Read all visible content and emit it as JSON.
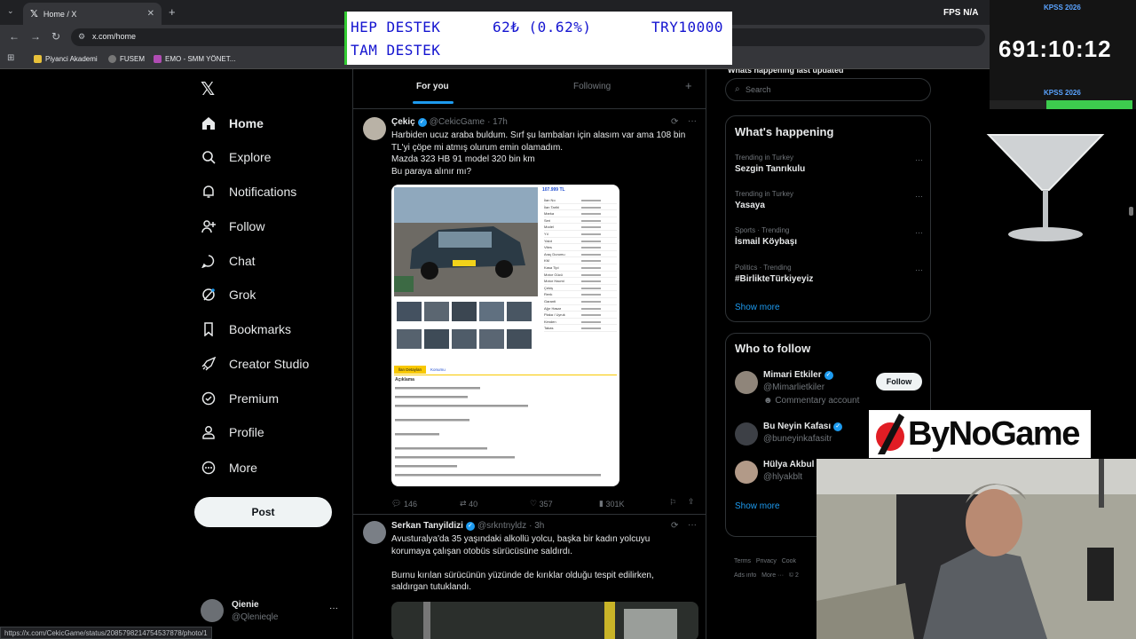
{
  "browser": {
    "tab_title": "Home / X",
    "url": "x.com/home",
    "bookmarks": [
      "Piyanci Akademi",
      "FUSEM",
      "EMO - SMM YÖNET..."
    ],
    "fps_label": "FPS",
    "fps_value": "N/A",
    "status_url": "https://x.com/CekicGame/status/2085798214754537878/photo/1"
  },
  "ticker": {
    "line1_left": "HEP DESTEK",
    "line1_mid": "62₺ (0.62%)",
    "line1_right": "TRY10000",
    "line2": "TAM DESTEK"
  },
  "kpss": {
    "top_label": "KPSS 2026",
    "countdown": "691:10:12",
    "bottom_label": "KPSS 2026",
    "progress": 0.6
  },
  "nav": {
    "items": [
      {
        "label": "Home",
        "icon": "home-icon"
      },
      {
        "label": "Explore",
        "icon": "search-icon"
      },
      {
        "label": "Notifications",
        "icon": "bell-icon"
      },
      {
        "label": "Follow",
        "icon": "person-plus-icon"
      },
      {
        "label": "Chat",
        "icon": "chat-icon"
      },
      {
        "label": "Grok",
        "icon": "grok-icon"
      },
      {
        "label": "Bookmarks",
        "icon": "bookmark-icon"
      },
      {
        "label": "Creator Studio",
        "icon": "rocket-icon"
      },
      {
        "label": "Premium",
        "icon": "verified-icon"
      },
      {
        "label": "Profile",
        "icon": "person-icon"
      },
      {
        "label": "More",
        "icon": "more-circle-icon"
      }
    ],
    "post_label": "Post",
    "account_name": "Qienie",
    "account_handle": "@Qlenieqle"
  },
  "feed": {
    "tab_for_you": "For you",
    "tab_following": "Following",
    "tweets": [
      {
        "name": "Çekiç",
        "handle": "@CekicGame",
        "time": "· 17h",
        "lines": [
          "Harbiden ucuz araba buldum. Sırf şu lambaları için alasım var ama 108 bin",
          "TL'yi çöpe mi atmış olurum emin olamadım.",
          "Mazda 323 HB 91 model 320 bin km",
          "Bu paraya alınır mı?"
        ],
        "replies": "146",
        "reposts": "40",
        "likes": "357",
        "views": "301K"
      },
      {
        "name": "Serkan Tanyildizi",
        "handle": "@srkntnyldz",
        "time": "· 3h",
        "lines": [
          "Avusturalya'da 35 yaşındaki alkollü yolcu, başka bir kadın yolcuyu",
          "korumaya çalışan otobüs sürücüsüne saldırdı.",
          "",
          "Burnu kırılan sürücünün yüzünde de kırıklar olduğu tespit edilirken,",
          "saldırgan tutuklandı."
        ]
      }
    ]
  },
  "listing": {
    "price": "107.999 TL",
    "tab_active": "İlan Detayları",
    "tab_other": "Konumu",
    "desc_title": "Açıklama",
    "rows": [
      "İlan No",
      "İlan Tarihi",
      "Marka",
      "Seri",
      "Model",
      "Yıl",
      "Yakıt",
      "Vites",
      "Araç Durumu",
      "KM",
      "Kasa Tipi",
      "Motor Gücü",
      "Motor Hacmi",
      "Çekiş",
      "Renk",
      "Garanti",
      "Ağır Hasar",
      "Plaka / Uyruk",
      "Kimden",
      "Takas"
    ]
  },
  "right": {
    "cut_text": "Whats happening last updated",
    "search_placeholder": "Search",
    "whats_happening": "What's happening",
    "trends": [
      {
        "cat": "Trending in Turkey",
        "name": "Sezgin Tanrıkulu"
      },
      {
        "cat": "Trending in Turkey",
        "name": "Yasaya"
      },
      {
        "cat": "Sports · Trending",
        "name": "İsmail Köybaşı"
      },
      {
        "cat": "Politics · Trending",
        "name": "#BirlikteTürkiyeyiz"
      }
    ],
    "show_more": "Show more",
    "who_to_follow": "Who to follow",
    "follow_label": "Follow",
    "suggestions": [
      {
        "name": "Mimari Etkiler",
        "handle": "@Mimarlietkiler",
        "extra": "Commentary account"
      },
      {
        "name": "Bu Neyin Kafası",
        "handle": "@buneyinkafasitr",
        "extra": ""
      },
      {
        "name": "Hülya Akbul",
        "handle": "@hlyakblt",
        "extra": ""
      }
    ],
    "footer": [
      "Terms",
      "Privacy",
      "Cook",
      "Ads info",
      "More ···",
      "© 2"
    ]
  },
  "overlay": {
    "brand": "ByNoGame"
  }
}
